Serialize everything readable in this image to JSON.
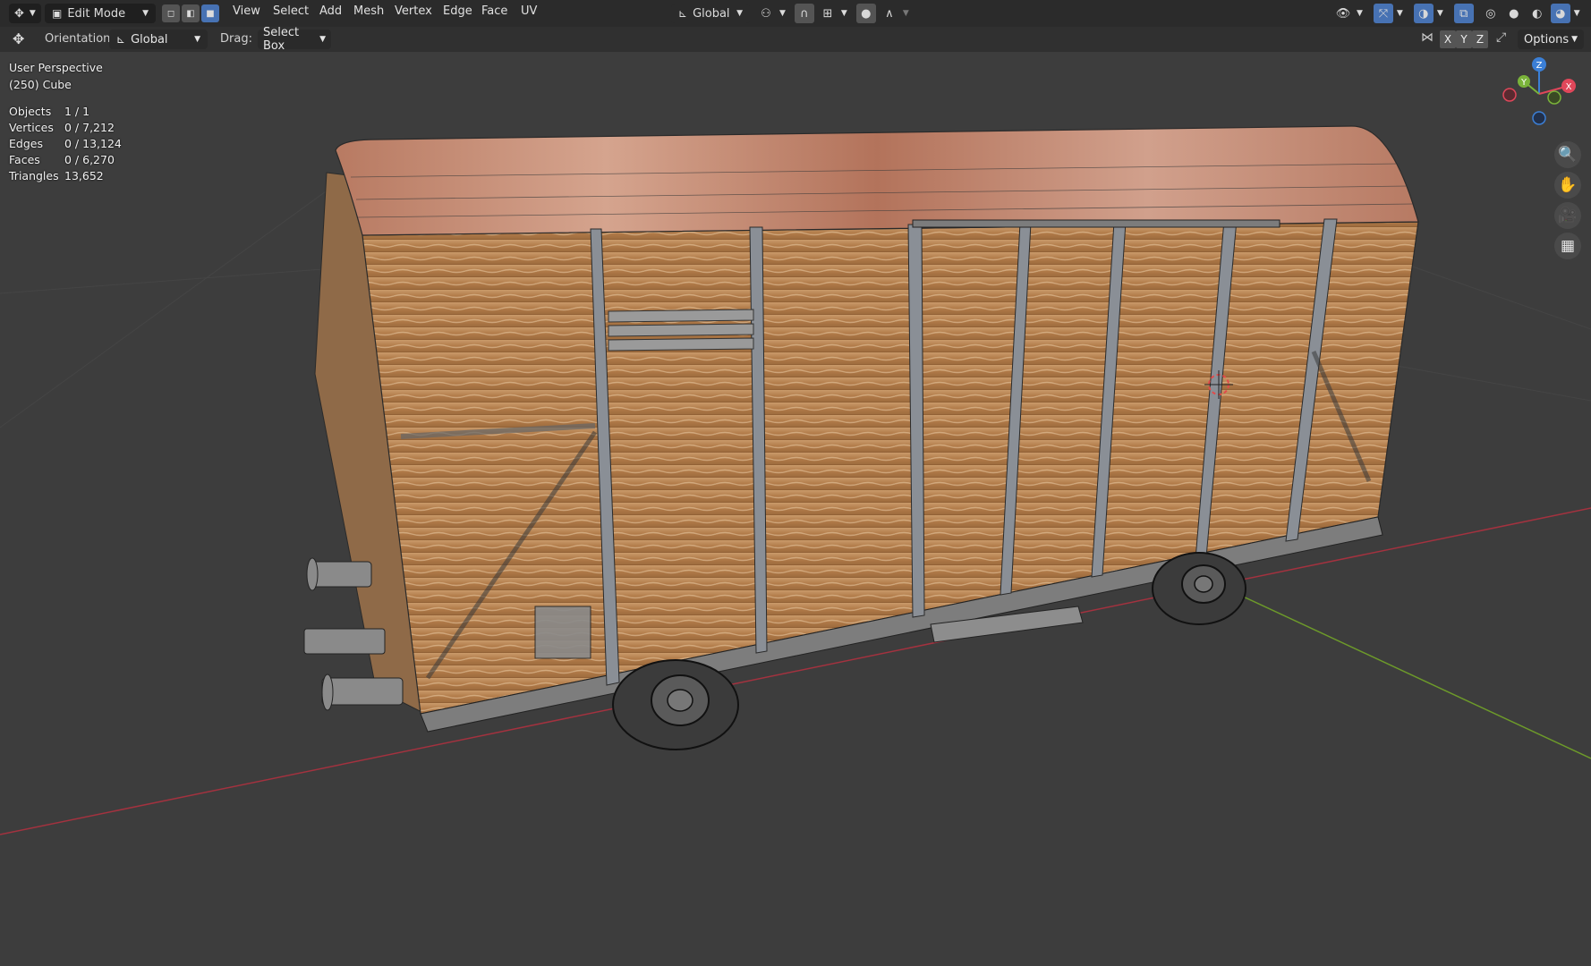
{
  "header": {
    "mode_label": "Edit Mode",
    "menus": [
      "View",
      "Select",
      "Add",
      "Mesh",
      "Vertex",
      "Edge",
      "Face",
      "UV"
    ],
    "transform_orientation": "Global",
    "accent_color": "#4772b3"
  },
  "tool_header": {
    "orientation_label": "Orientation:",
    "orientation_value": "Global",
    "drag_label": "Drag:",
    "drag_value": "Select Box",
    "axis_x": "X",
    "axis_y": "Y",
    "axis_z": "Z",
    "options_label": "Options"
  },
  "viewport": {
    "view_name": "User Perspective",
    "object_name": "(250) Cube",
    "stats": [
      {
        "label": "Objects",
        "value": "1 / 1"
      },
      {
        "label": "Vertices",
        "value": "0 / 7,212"
      },
      {
        "label": "Edges",
        "value": "0 / 13,124"
      },
      {
        "label": "Faces",
        "value": "0 / 6,270"
      },
      {
        "label": "Triangles",
        "value": "13,652"
      }
    ],
    "gizmo": {
      "x": "X",
      "y": "Y",
      "z": "Z",
      "x_color": "#e0475a",
      "y_color": "#7ab33a",
      "z_color": "#3b7fd6"
    },
    "nav_icons": [
      "zoom-icon",
      "pan-hand-icon",
      "camera-icon",
      "grid-perspective-icon"
    ]
  }
}
